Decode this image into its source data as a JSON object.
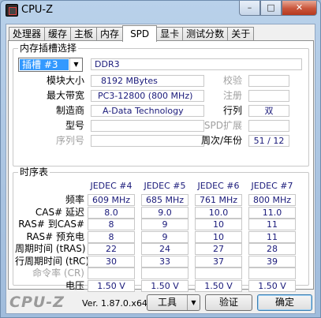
{
  "window": {
    "title": "CPU-Z",
    "controls": {
      "minimize": "–",
      "maximize": "□",
      "close": "✕"
    }
  },
  "tabs": [
    "处理器",
    "缓存",
    "主板",
    "内存",
    "SPD",
    "显卡",
    "测试分数",
    "关于"
  ],
  "active_tab": "SPD",
  "slot_group": {
    "title": "内存插槽选择",
    "slot_select": "插槽 #3",
    "type": "DDR3",
    "module_size_label": "模块大小",
    "module_size": "8192 MBytes",
    "max_bandwidth_label": "最大带宽",
    "max_bandwidth": "PC3-12800 (800 MHz)",
    "manufacturer_label": "制造商",
    "manufacturer": "A-Data Technology",
    "part_label": "型号",
    "part": "",
    "serial_label": "序列号",
    "serial": "",
    "correction_label": "校验",
    "correction": "",
    "registered_label": "注册",
    "registered": "",
    "ranks_label": "行列",
    "ranks": "双",
    "spd_ext_label": "SPD扩展",
    "spd_ext": "",
    "week_year_label": "周次/年份",
    "week_year": "51 / 12"
  },
  "timing_group": {
    "title": "时序表",
    "columns": [
      "JEDEC #4",
      "JEDEC #5",
      "JEDEC #6",
      "JEDEC #7"
    ],
    "rows": [
      {
        "label": "频率",
        "values": [
          "609 MHz",
          "685 MHz",
          "761 MHz",
          "800 MHz"
        ],
        "dim": false
      },
      {
        "label": "CAS# 延迟",
        "values": [
          "8.0",
          "9.0",
          "10.0",
          "11.0"
        ],
        "dim": false
      },
      {
        "label": "RAS# 到CAS#",
        "values": [
          "8",
          "9",
          "10",
          "11"
        ],
        "dim": false
      },
      {
        "label": "RAS# 预充电",
        "values": [
          "8",
          "9",
          "10",
          "11"
        ],
        "dim": false
      },
      {
        "label": "周期时间 (tRAS)",
        "values": [
          "22",
          "24",
          "27",
          "28"
        ],
        "dim": false
      },
      {
        "label": "行周期时间 (tRC)",
        "values": [
          "30",
          "33",
          "37",
          "39"
        ],
        "dim": false
      },
      {
        "label": "命令率 (CR)",
        "values": [
          "",
          "",
          "",
          ""
        ],
        "dim": true
      },
      {
        "label": "电压",
        "values": [
          "1.50 V",
          "1.50 V",
          "1.50 V",
          "1.50 V"
        ],
        "dim": false
      }
    ]
  },
  "footer": {
    "brand": "CPU-Z",
    "version": "Ver. 1.87.0.x64",
    "tools_label": "工具",
    "validate_label": "验证",
    "ok_label": "确定"
  }
}
